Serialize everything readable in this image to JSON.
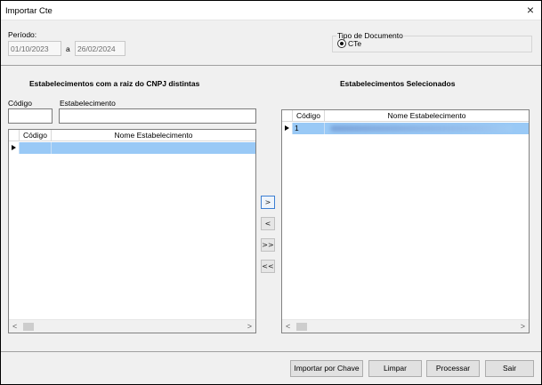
{
  "window": {
    "title": "Importar Cte",
    "close_icon": "×"
  },
  "periodo": {
    "label": "Período:",
    "start_date": "01/10/2023",
    "separator": "a",
    "end_date": "26/02/2024"
  },
  "tipo_documento": {
    "legend": "Tipo de Documento",
    "option_label": "CTe",
    "selected": true
  },
  "left_panel": {
    "heading": "Estabelecimentos com a raiz do CNPJ distintas",
    "codigo_label": "Código",
    "estabelecimento_label": "Estabelecimento",
    "codigo_value": "",
    "estabelecimento_value": "",
    "columns": [
      "Código",
      "Nome Estabelecimento"
    ],
    "rows": [
      {
        "codigo": "",
        "nome": ""
      }
    ]
  },
  "right_panel": {
    "heading": "Estabelecimentos Selecionados",
    "columns": [
      "Código",
      "Nome Estabelecimento"
    ],
    "rows": [
      {
        "codigo": "1",
        "nome": ""
      }
    ]
  },
  "move_buttons": {
    "add_one": ">",
    "remove_one": "<",
    "add_all": ">>",
    "remove_all": "<<"
  },
  "scroll_arrows": {
    "left": "<",
    "right": ">"
  },
  "footer_buttons": {
    "importar": "Importar por Chave",
    "limpar": "Limpar",
    "processar": "Processar",
    "sair": "Sair"
  },
  "colors": {
    "selection": "#99c9f6",
    "window_bg": "#f0f0f0",
    "focus_border": "#3c7fd3"
  }
}
